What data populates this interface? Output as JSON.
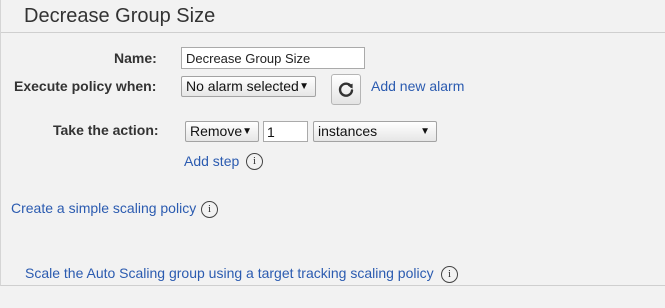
{
  "panel": {
    "title": "Decrease Group Size"
  },
  "form": {
    "name_label": "Name:",
    "name_value": "Decrease Group Size",
    "execute_label": "Execute policy when:",
    "alarm_select": "No alarm selected",
    "add_alarm_link": "Add new alarm",
    "action_label": "Take the action:",
    "action_select": "Remove",
    "amount_value": "1",
    "unit_select": "instances",
    "add_step_link": "Add step"
  },
  "links": {
    "simple_policy": "Create a simple scaling policy",
    "target_tracking": "Scale the Auto Scaling group using a target tracking scaling policy"
  },
  "icons": {
    "refresh": "refresh-icon",
    "info": "info-icon",
    "dropdown": "caret-down-icon"
  },
  "colors": {
    "link": "#2b5bb0",
    "background": "#f2f2f2"
  }
}
